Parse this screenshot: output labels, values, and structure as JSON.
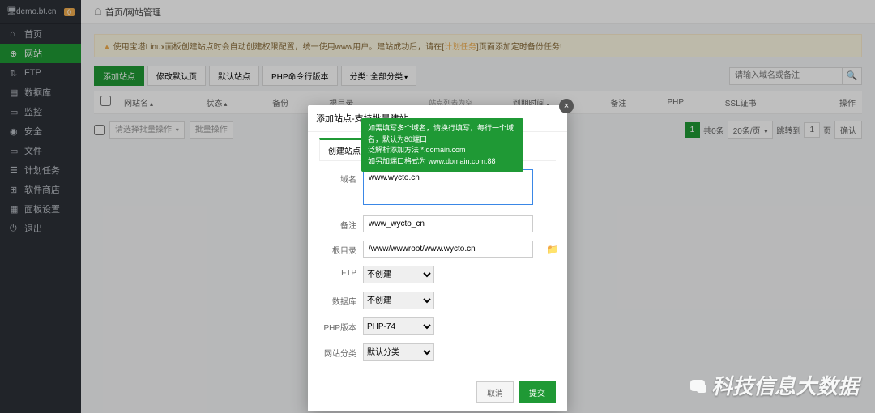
{
  "host": {
    "label": "demo.bt.cn",
    "badge": "0"
  },
  "sidebar": {
    "items": [
      {
        "label": "首页"
      },
      {
        "label": "网站",
        "active": true
      },
      {
        "label": "FTP"
      },
      {
        "label": "数据库"
      },
      {
        "label": "监控"
      },
      {
        "label": "安全"
      },
      {
        "label": "文件"
      },
      {
        "label": "计划任务"
      },
      {
        "label": "软件商店"
      },
      {
        "label": "面板设置"
      },
      {
        "label": "退出"
      }
    ]
  },
  "crumb": {
    "home": "首页",
    "sep": " / ",
    "page": "网站管理"
  },
  "alert": {
    "text_a": "使用宝塔Linux面板创建站点时会自动创建权限配置，统一使用www用户。建站成功后，请在[",
    "link": "计划任务",
    "text_b": "]页面添加定时备份任务!"
  },
  "tabs": {
    "add": "添加站点",
    "modify": "修改默认页",
    "default": "默认站点",
    "php": "PHP命令行版本",
    "category": "分类: 全部分类"
  },
  "search": {
    "placeholder": "请输入域名或备注"
  },
  "columns": {
    "c0": "",
    "name": "网站名",
    "status": "状态",
    "backup": "备份",
    "root": "根目录",
    "empty_msg": "站点列表为空",
    "expire": "到期时间",
    "note": "备注",
    "php": "PHP",
    "ssl": "SSL证书",
    "ops": "操作"
  },
  "bulk": {
    "sel_placeholder": "请选择批量操作",
    "apply": "批量操作"
  },
  "pager": {
    "cur": "1",
    "total": "共0条",
    "perpage": "20条/页",
    "jump_pre": "跳转到",
    "jump_val": "1",
    "jump_post": "页",
    "ok": "确认"
  },
  "modal": {
    "title": "添加站点-支持批量建站",
    "tab": "创建站点",
    "labels": {
      "domain": "域名",
      "note": "备注",
      "root": "根目录",
      "ftp": "FTP",
      "db": "数据库",
      "php": "PHP版本",
      "cat": "网站分类"
    },
    "values": {
      "domain": "www.wycto.cn",
      "note": "www_wycto_cn",
      "root": "/www/wwwroot/www.wycto.cn",
      "ftp": "不创建",
      "db": "不创建",
      "php": "PHP-74",
      "cat": "默认分类"
    },
    "buttons": {
      "cancel": "取消",
      "submit": "提交"
    }
  },
  "tooltip": {
    "l1": "如需填写多个域名，请换行填写，每行一个域名，默认为80端口",
    "l2": "泛解析添加方法 *.domain.com",
    "l3": "如另加端口格式为 www.domain.com:88"
  },
  "watermark": "科技信息大数据"
}
